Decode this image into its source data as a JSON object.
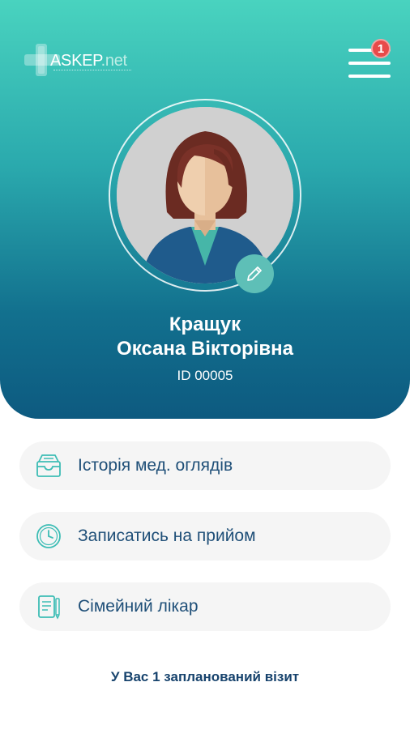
{
  "app": {
    "logo_main": "ASKEP",
    "logo_suffix": ".net"
  },
  "header": {
    "notification_count": "1",
    "menu_icon": "hamburger-icon"
  },
  "profile": {
    "last_name": "Кращук",
    "first_middle_name": "Оксана Вікторівна",
    "id_label": "ID 00005",
    "edit_icon": "pencil-icon"
  },
  "menu": {
    "items": [
      {
        "label": "Історія мед. оглядів",
        "icon": "archive-tray-icon"
      },
      {
        "label": "Записатись на прийом",
        "icon": "clock-icon"
      },
      {
        "label": "Сімейний лікар",
        "icon": "notepad-pen-icon"
      }
    ]
  },
  "footer": {
    "visit_note": "У Вас 1 запланований візит"
  },
  "colors": {
    "gradient_top": "#49d3bf",
    "gradient_bottom": "#0d5a80",
    "accent_teal": "#3dbdb5",
    "text_dark_blue": "#1f4f78",
    "badge_red": "#e84a4a"
  }
}
